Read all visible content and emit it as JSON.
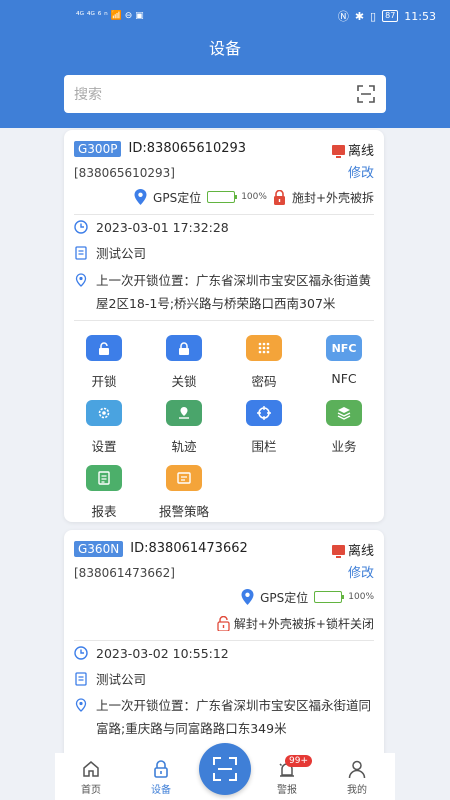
{
  "status": {
    "left_icons": "⁴ᴳ ⁴ᴳ ⁶ ⁿ 📶 ⊖ ▣",
    "nfc": "Ⓝ",
    "bluetooth": "✱",
    "vibrate": "▯",
    "battery": "87",
    "time": "11:53"
  },
  "header": {
    "title": "设备"
  },
  "search": {
    "placeholder": "搜索"
  },
  "device1": {
    "model": "G300P",
    "id": "ID:838065610293",
    "status": "离线",
    "code": "[838065610293]",
    "modify": "修改",
    "gps": "GPS定位",
    "battery": "100%",
    "lock_state": "施封+外壳被拆",
    "time": "2023-03-01 17:32:28",
    "company": "测试公司",
    "location": "上一次开锁位置：广东省深圳市宝安区福永街道黄屋2区18-1号;桥兴路与桥荣路口西南307米"
  },
  "actions": [
    {
      "label": "开锁",
      "icon": "unlock-icon",
      "color": "#3d7ee8"
    },
    {
      "label": "关锁",
      "icon": "lock-icon",
      "color": "#3d7ee8"
    },
    {
      "label": "密码",
      "icon": "keypad-icon",
      "color": "#f4a43a"
    },
    {
      "label": "NFC",
      "icon": "nfc-icon",
      "color": "#5b9ee9"
    },
    {
      "label": "设置",
      "icon": "gear-icon",
      "color": "#4aa3e0"
    },
    {
      "label": "轨迹",
      "icon": "track-icon",
      "color": "#4aa56b"
    },
    {
      "label": "围栏",
      "icon": "fence-icon",
      "color": "#3d7ee8"
    },
    {
      "label": "业务",
      "icon": "layers-icon",
      "color": "#5bb05a"
    },
    {
      "label": "报表",
      "icon": "report-icon",
      "color": "#4caf6a"
    },
    {
      "label": "报警策略",
      "icon": "alarm-policy-icon",
      "color": "#f4a43a"
    }
  ],
  "device2": {
    "model": "G360N",
    "id": "ID:838061473662",
    "status": "离线",
    "code": "[838061473662]",
    "modify": "修改",
    "gps": "GPS定位",
    "battery": "100%",
    "lock_state": "解封+外壳被拆+锁杆关闭",
    "time": "2023-03-02 10:55:12",
    "company": "测试公司",
    "location": "上一次开锁位置：广东省深圳市宝安区福永街道同富路;重庆路与同富路路口东349米"
  },
  "tabs": {
    "home": "首页",
    "devices": "设备",
    "alarms": "警报",
    "alarm_badge": "99+",
    "mine": "我的"
  },
  "colors": {
    "primary": "#3f7fd7",
    "danger": "#e04a3a",
    "battery": "#62b440"
  }
}
